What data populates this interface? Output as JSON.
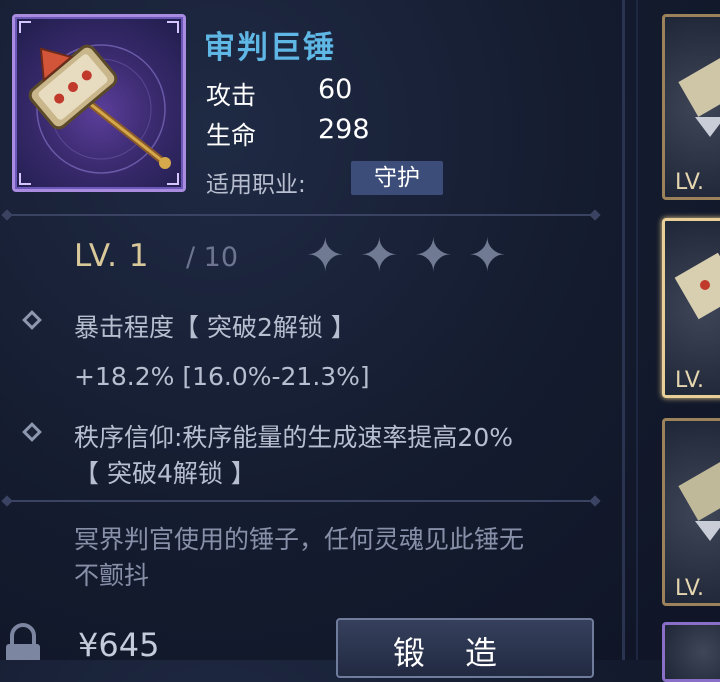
{
  "weapon": {
    "name": "审判巨锤",
    "stats": [
      {
        "label": "攻击",
        "value": "60"
      },
      {
        "label": "生命",
        "value": "298"
      }
    ],
    "job_label": "适用职业:",
    "job_value": "守护"
  },
  "level": {
    "prefix": "LV.",
    "current": "1",
    "max": "/ 10",
    "stars_total": 4,
    "stars_filled": 0
  },
  "attributes": [
    {
      "line1": "暴击程度【 突破2解锁 】",
      "line2": "+18.2% [16.0%-21.3%]"
    },
    {
      "line1": "秩序信仰:秩序能量的生成速率提高20%",
      "line2": "【 突破4解锁 】"
    }
  ],
  "description": {
    "line1": "冥界判官使用的锤子，任何灵魂见此锤无",
    "line2": "不颤抖"
  },
  "footer": {
    "price": "645",
    "forge_label": "锻造"
  },
  "side_cards": [
    {
      "level_label": "LV."
    },
    {
      "level_label": "LV."
    },
    {
      "level_label": "LV."
    }
  ],
  "colors": {
    "title": "#5fb7e6",
    "level": "#d9c89a",
    "job_badge": "#3b4d78",
    "card_border": "#9c825a"
  }
}
